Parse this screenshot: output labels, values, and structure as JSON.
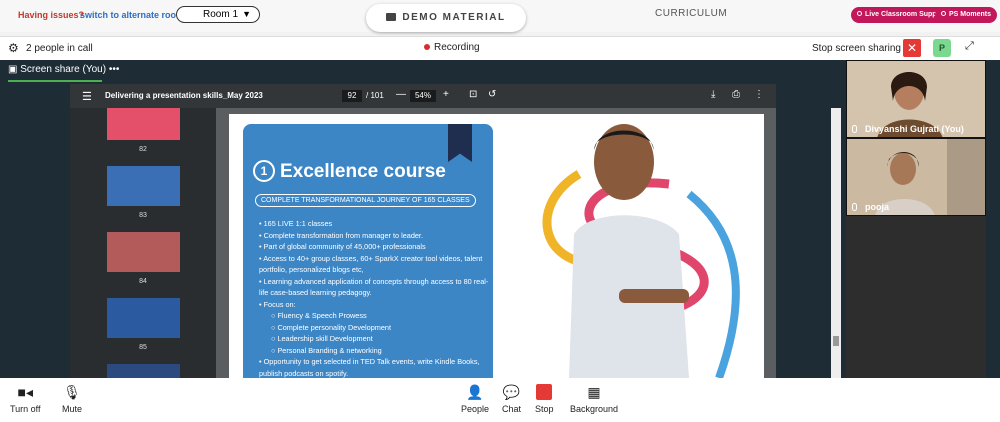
{
  "top": {
    "issues_text": "Having issues?",
    "switch_link": "switch to alternate room",
    "room_select": "Room 1",
    "demo_button": "DEMO MATERIAL",
    "curriculum": "CURRICULUM",
    "support_pill": "Live Classroom Support",
    "moments_pill": "PS Moments"
  },
  "call": {
    "people_count": "2 people in call",
    "recording": "Recording",
    "stop_sharing": "Stop screen sharing",
    "participant_badge": "P"
  },
  "share": {
    "title": "Screen share (You)",
    "menu": "•••"
  },
  "pdf": {
    "title": "Delivering a presentation skills_May 2023",
    "page_current": "92",
    "page_total": "/ 101",
    "zoom": "54%",
    "thumbs": [
      "82",
      "83",
      "84",
      "85"
    ]
  },
  "slide": {
    "number": "1",
    "title": "Excellence course",
    "subtitle": "COMPLETE TRANSFORMATIONAL JOURNEY OF 165 CLASSES",
    "bullets": [
      "165 LIVE 1:1 classes",
      "Complete transformation from manager to leader.",
      "Part of global community of 45,000+ professionals",
      "Access to 40+ group classes, 60+ SparkX creator tool videos, talent portfolio, personalized blogs etc,",
      "Learning advanced application of concepts through access to 80 real-life case-based learning pedagogy.",
      "Focus on:"
    ],
    "sub_bullets": [
      "Fluency & Speech Prowess",
      "Complete personality Development",
      "Leadership skill Development",
      "Personal Branding & networking"
    ],
    "last_bullet": "Opportunity to get selected in TED Talk events, write Kindle Books, publish podcasts on spotify."
  },
  "participants": [
    {
      "name": "Divyanshi Gujrati (You)"
    },
    {
      "name": "pooja"
    }
  ],
  "controls": {
    "turn_off": "Turn off",
    "mute": "Mute",
    "people": "People",
    "chat": "Chat",
    "stop": "Stop",
    "background": "Background"
  },
  "colors": {
    "accent_pink": "#c2185b",
    "record_red": "#d32f2f",
    "card_blue": "#3d86c6"
  }
}
